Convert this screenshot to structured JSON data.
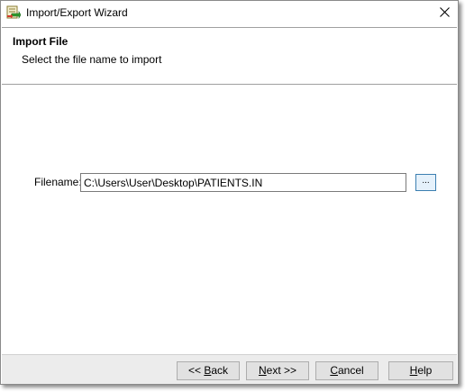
{
  "window": {
    "title": "Import/Export Wizard",
    "close_label": "✕"
  },
  "header": {
    "title": "Import File",
    "subtitle": "Select the file name to import"
  },
  "form": {
    "filename_label": "Filename:",
    "filename_value": "C:\\Users\\User\\Desktop\\PATIENTS.IN",
    "browse_label": "..."
  },
  "footer": {
    "back_prefix": "<< ",
    "back_mnemonic": "B",
    "back_rest": "ack",
    "next_mnemonic": "N",
    "next_rest": "ext >>",
    "cancel_mnemonic": "C",
    "cancel_rest": "ancel",
    "help_mnemonic": "H",
    "help_rest": "elp"
  },
  "colors": {
    "footer_bg": "#ececec",
    "button_bg": "#e1e1e1",
    "browse_border": "#3c7fb1",
    "browse_bg": "#e5f1fb"
  },
  "icons": {
    "app": "import-export-wizard-icon",
    "close": "close-icon"
  }
}
